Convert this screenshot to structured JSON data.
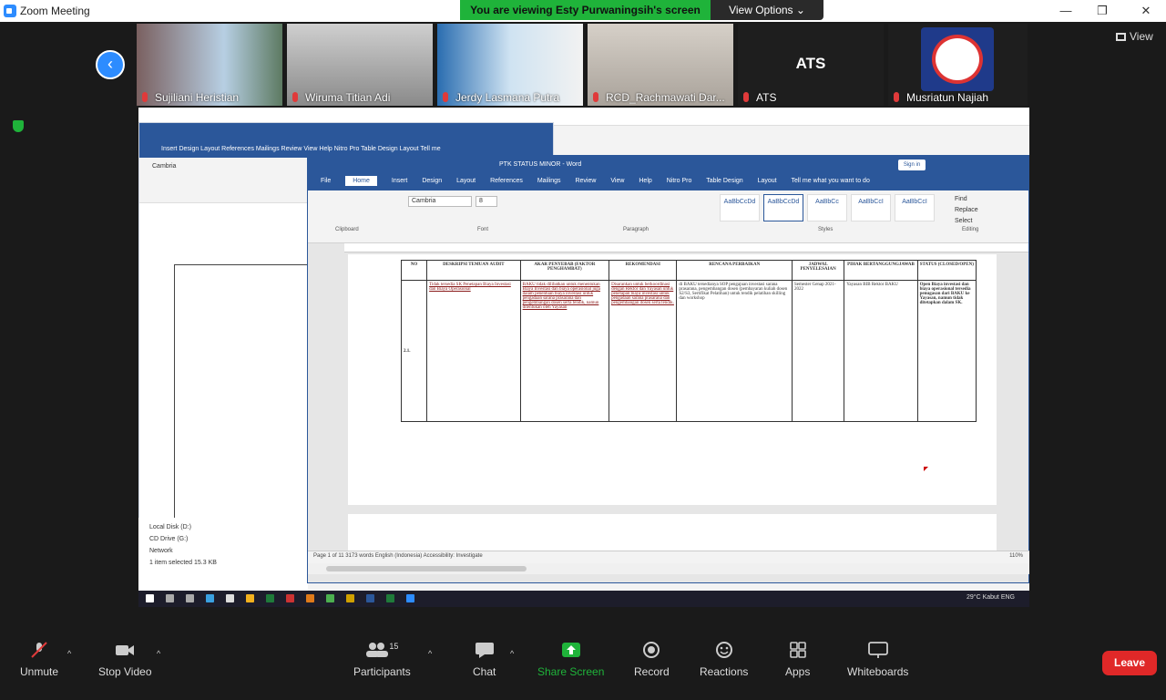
{
  "window": {
    "title": "Zoom Meeting",
    "minimize": "—",
    "restore": "❐",
    "close": "✕"
  },
  "share_banner": {
    "text": "You are viewing Esty Purwaningsih's screen",
    "view_options": "View Options ⌄"
  },
  "gallery": {
    "view_label": "View",
    "participants": [
      {
        "name": "Sujiliani Heristian"
      },
      {
        "name": "Wiruma Titian Adi"
      },
      {
        "name": "Jerdy Lasmana Putra"
      },
      {
        "name": "RCD_Rachmawati Dar..."
      },
      {
        "name": "ATS",
        "avatar_text": "ATS"
      },
      {
        "name": "Musriatun Najiah"
      }
    ]
  },
  "shared_screen": {
    "bg_word": {
      "menu": "Insert  Design  Layout  References  Mailings  Review  View  Help  Nitro Pro  Table Design  Layout  Tell me",
      "font": "Cambria"
    },
    "explorer": {
      "items": [
        "Local Disk (D:)",
        "CD Drive (G:)",
        "Network"
      ],
      "footer": "1 item selected  15.3 KB"
    },
    "fg_word": {
      "title": "PTK STATUS MINOR - Word",
      "signin": "Sign in",
      "tabs": [
        "File",
        "Home",
        "Insert",
        "Design",
        "Layout",
        "References",
        "Mailings",
        "Review",
        "View",
        "Help",
        "Nitro Pro",
        "Table Design",
        "Layout",
        "Tell me what you want to do"
      ],
      "active_tab": "Home",
      "font": "Cambria",
      "font_size": "8",
      "clipboard": "Clipboard",
      "font_grp": "Font",
      "paragraph": "Paragraph",
      "styles_grp": "Styles",
      "editing": "Editing",
      "styles": [
        "AaBbCcDd",
        "AaBbCcDd",
        "AaBbCc",
        "AaBbCcI",
        "AaBbCcI"
      ],
      "edit_items": [
        "Find",
        "Replace",
        "Select"
      ],
      "table_headers": [
        "NO",
        "DESKRIPSI TEMUAN AUDIT",
        "AKAR PENYEBAB (FAKTOR PENGHAMBAT)",
        "REKOMENDASI",
        "RENCANA PERBAIKAN",
        "JADWAL PENYELESAIAN",
        "PIHAK BERTANGGUNGJAWAB",
        "STATUS (CLOSED/OPEN)"
      ],
      "table_row": [
        "2.1.",
        "Tidak tersedia SK Penetapan Biaya Investasi dan Biaya Operasional",
        "BAKU tidak dilibatkan untuk menentukan Biaya Investasi dan biaya operasional juga dalam penentuan biaya investasi untuk pengadaan sarana prasarana dan pengembangan dosen serta tendik, namun ditentukan oleh Yayasan",
        "Disarankan untuk berkoordinasi dengan Rektor dan Yayasan untuk penetapan biaya investasi untuk pengadaan sarana prasarana dan pengembangan dosen serta tendik.",
        "di BAKU tersedianya SOP pengajuan investasi sarana prasarana, pengembangan dosen (pembayaran kuliah dosen S2/S3, Sertifikat Pelatihan) untuk tendik pelatihan skilling dan workshop",
        "Semester Genap 2021-2022",
        "Yayasan BIB Rektor BAKU",
        "Open Biaya investasi dan biaya operasional tersedia penugasan dari BAKU ke Yayasan, namun tidak ditetapkan dalam SK."
      ],
      "status": "Page 1 of 11    3173 words    English (Indonesia)    Accessibility: Investigate",
      "zoom": "110%"
    },
    "taskbar": {
      "tray": "29°C Kabut  ENG"
    }
  },
  "controls": {
    "unmute": "Unmute",
    "stop_video": "Stop Video",
    "participants": "Participants",
    "participants_count": "15",
    "chat": "Chat",
    "share_screen": "Share Screen",
    "record": "Record",
    "reactions": "Reactions",
    "apps": "Apps",
    "whiteboards": "Whiteboards",
    "leave": "Leave"
  },
  "colors": {
    "zoom_blue": "#2d8cff",
    "share_green": "#1fb33a",
    "leave_red": "#e02828",
    "word_blue": "#2b579a"
  }
}
